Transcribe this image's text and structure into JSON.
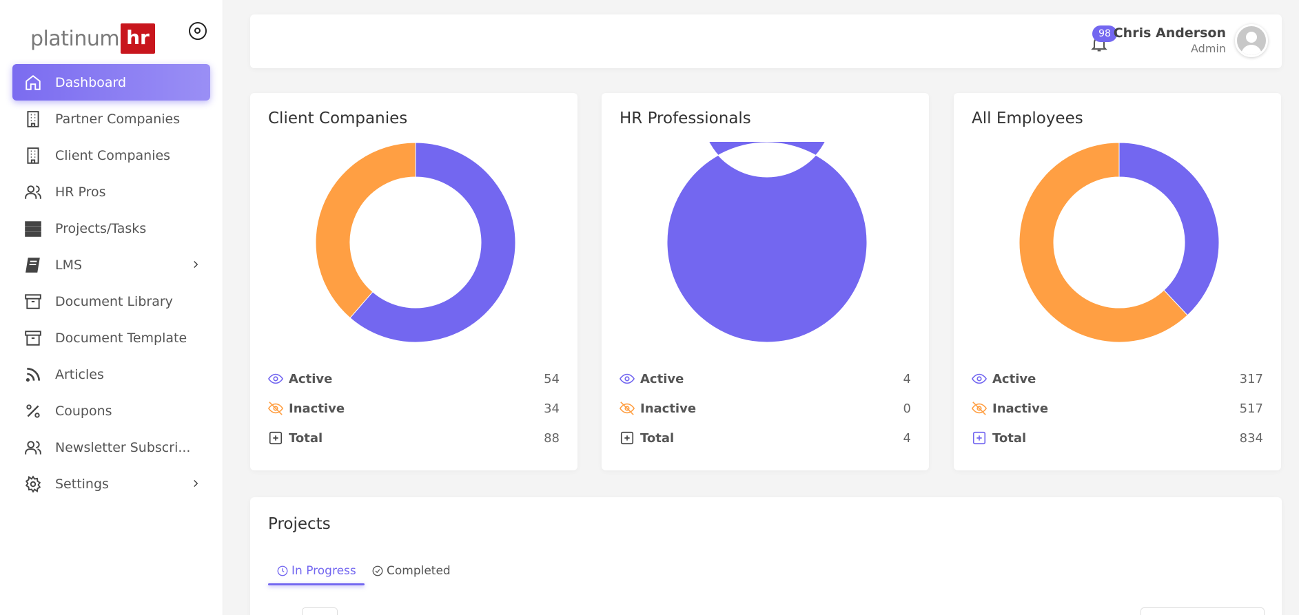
{
  "brand": {
    "text": "platinum",
    "highlight": "hr"
  },
  "sidebar": {
    "items": [
      {
        "label": "Dashboard",
        "icon": "home-icon"
      },
      {
        "label": "Partner Companies",
        "icon": "building-icon"
      },
      {
        "label": "Client Companies",
        "icon": "building-icon"
      },
      {
        "label": "HR Pros",
        "icon": "users-icon"
      },
      {
        "label": "Projects/Tasks",
        "icon": "server-icon"
      },
      {
        "label": "LMS",
        "icon": "book-icon"
      },
      {
        "label": "Document Library",
        "icon": "archive-icon"
      },
      {
        "label": "Document Template",
        "icon": "archive-icon"
      },
      {
        "label": "Articles",
        "icon": "rss-icon"
      },
      {
        "label": "Coupons",
        "icon": "percent-icon"
      },
      {
        "label": "Newsletter Subscri...",
        "icon": "users-icon"
      },
      {
        "label": "Settings",
        "icon": "gear-icon"
      }
    ]
  },
  "header": {
    "notifications": "98",
    "user_name": "Chris Anderson",
    "user_role": "Admin"
  },
  "colors": {
    "active": "#7367f0",
    "inactive": "#ff9f43"
  },
  "cards": [
    {
      "title": "Client Companies",
      "active_label": "Active",
      "active": "54",
      "inactive_label": "Inactive",
      "inactive": "34",
      "total_label": "Total",
      "total": "88"
    },
    {
      "title": "HR Professionals",
      "active_label": "Active",
      "active": "4",
      "inactive_label": "Inactive",
      "inactive": "0",
      "total_label": "Total",
      "total": "4"
    },
    {
      "title": "All Employees",
      "active_label": "Active",
      "active": "317",
      "inactive_label": "Inactive",
      "inactive": "517",
      "total_label": "Total",
      "total": "834"
    }
  ],
  "chart_data": [
    {
      "type": "pie",
      "categories": [
        "Active",
        "Inactive"
      ],
      "values": [
        54,
        34
      ]
    },
    {
      "type": "pie",
      "categories": [
        "Active",
        "Inactive"
      ],
      "values": [
        4,
        0
      ]
    },
    {
      "type": "pie",
      "categories": [
        "Active",
        "Inactive"
      ],
      "values": [
        317,
        517
      ]
    }
  ],
  "projects": {
    "title": "Projects",
    "tabs": [
      {
        "label": "In Progress"
      },
      {
        "label": "Completed"
      }
    ]
  }
}
